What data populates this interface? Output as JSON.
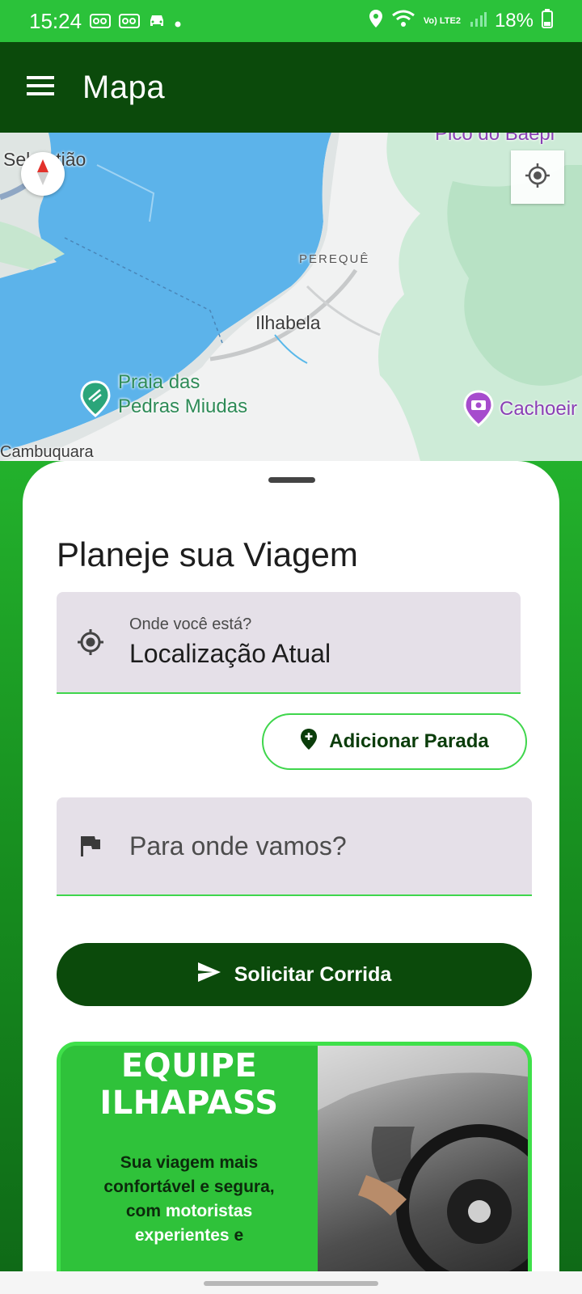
{
  "status_bar": {
    "time": "15:24",
    "network": "Vo) LTE2",
    "battery": "18%"
  },
  "app_bar": {
    "title": "Mapa"
  },
  "map": {
    "labels": {
      "sebastiao": "Sebastião",
      "pico": "Pico do Baepi",
      "pereque": "PEREQUÊ",
      "ilhabela": "Ilhabela",
      "praia_line1": "Praia das",
      "praia_line2": "Pedras Miudas",
      "cachoeira": "Cachoeir",
      "cambuquara": "Cambuquara"
    }
  },
  "sheet": {
    "title": "Planeje sua Viagem",
    "origin": {
      "label": "Onde você está?",
      "value": "Localização Atual"
    },
    "add_stop_label": "Adicionar Parada",
    "destination": {
      "placeholder": "Para onde vamos?"
    },
    "request_label": "Solicitar Corrida"
  },
  "banner": {
    "title_line1": "EQUIPE",
    "title_line2": "ILHAPASS",
    "text_line1": "Sua viagem mais",
    "text_line2": "confortável e segura,",
    "text_line3_prefix": "com ",
    "text_line3_highlight": "motoristas",
    "text_line4_highlight": "experientes",
    "text_line4_suffix": " e"
  },
  "colors": {
    "primary_dark": "#0b4a0b",
    "status_green": "#2bc23a",
    "accent_green": "#3fd64c",
    "field_bg": "#e5e0e8"
  }
}
